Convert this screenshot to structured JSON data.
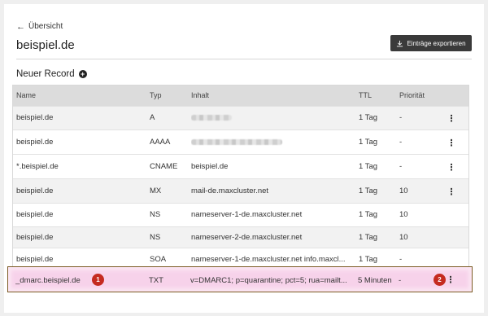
{
  "back": {
    "icon": "arrow-left-icon",
    "label": "Übersicht"
  },
  "title": "beispiel.de",
  "export_button": {
    "icon": "download-icon",
    "label": "Einträge exportieren"
  },
  "new_record": {
    "label": "Neuer Record",
    "icon": "plus-circle-icon"
  },
  "table": {
    "headers": {
      "name": "Name",
      "type": "Typ",
      "content": "Inhalt",
      "ttl": "TTL",
      "priority": "Priorität"
    },
    "rows": [
      {
        "name": "beispiel.de",
        "type": "A",
        "content": "",
        "content_blurred": true,
        "ttl": "1 Tag",
        "priority": "-",
        "menu": "⋮"
      },
      {
        "name": "beispiel.de",
        "type": "AAAA",
        "content": "",
        "content_blurred": true,
        "ttl": "1 Tag",
        "priority": "-",
        "menu": "⋮"
      },
      {
        "name": "*.beispiel.de",
        "type": "CNAME",
        "content": "beispiel.de",
        "ttl": "1 Tag",
        "priority": "-",
        "menu": "⋮"
      },
      {
        "name": "beispiel.de",
        "type": "MX",
        "content": "mail-de.maxcluster.net",
        "ttl": "1 Tag",
        "priority": "10",
        "menu": "⋮"
      },
      {
        "name": "beispiel.de",
        "type": "NS",
        "content": "nameserver-1-de.maxcluster.net",
        "ttl": "1 Tag",
        "priority": "10",
        "menu": ""
      },
      {
        "name": "beispiel.de",
        "type": "NS",
        "content": "nameserver-2-de.maxcluster.net",
        "ttl": "1 Tag",
        "priority": "10",
        "menu": ""
      },
      {
        "name": "beispiel.de",
        "type": "SOA",
        "content": "nameserver-1-de.maxcluster.net info.maxcl...",
        "ttl": "1 Tag",
        "priority": "-",
        "menu": ""
      }
    ],
    "highlighted_row": {
      "name": "_dmarc.beispiel.de",
      "type": "TXT",
      "content": "v=DMARC1; p=quarantine; pct=5; rua=mailt...",
      "ttl": "5 Minuten",
      "priority": "-",
      "menu": "⋮"
    }
  },
  "annotations": {
    "badge1": "1",
    "badge2": "2",
    "color": "#c52b20",
    "highlight_border": "#7a5a22",
    "highlight_fill": "#fbe6f3"
  }
}
